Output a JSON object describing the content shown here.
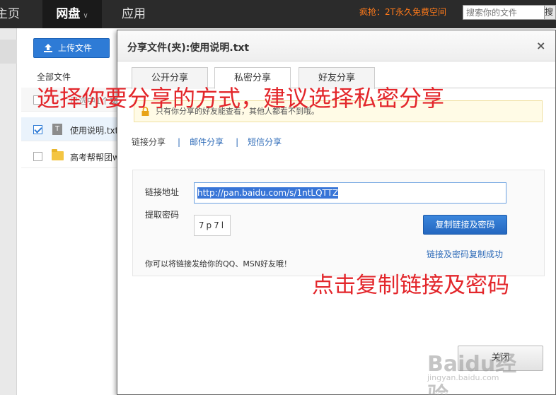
{
  "nav": {
    "home": "主页",
    "pan": "网盘",
    "app": "应用",
    "promo": "疯抢：2T永久免费空间",
    "search_placeholder": "搜索你的文件",
    "search_btn": "搜索"
  },
  "files": {
    "upload_label": "上传文件",
    "all_files": "全部文件",
    "rows": [
      {
        "name": "已选中1个文件/文件夹"
      },
      {
        "name": "使用说明.txt"
      },
      {
        "name": "高考帮帮团w"
      }
    ]
  },
  "dialog": {
    "title": "分享文件(夹):使用说明.txt",
    "close": "×",
    "tabs": [
      "公开分享",
      "私密分享",
      "好友分享"
    ],
    "notice": "只有你分享的好友能查看，其他人都看不到哦。",
    "subtabs": {
      "link": "链接分享",
      "mail": "邮件分享",
      "sms": "短信分享",
      "sep": "|"
    },
    "link_label": "链接地址",
    "link_value": "http://pan.baidu.com/s/1ntLQTTZ",
    "password_label": "提取密码",
    "password_value": "7p7l",
    "copy_button": "复制链接及密码",
    "copied_msg": "链接及密码复制成功",
    "hint": "你可以将链接发给你的QQ、MSN好友哦！",
    "close_button": "关闭"
  },
  "annotations": {
    "top": "选择你要分享的方式，建议选择私密分享",
    "bottom": "点击复制链接及密码"
  },
  "watermark": {
    "main": "Baidu经验",
    "sub": "jingyan.baidu.com"
  },
  "colors": {
    "annotation": "#e3262b",
    "primary_button": "#2e7bd6",
    "link": "#2e6bb8",
    "promo": "#ff7a1a"
  }
}
